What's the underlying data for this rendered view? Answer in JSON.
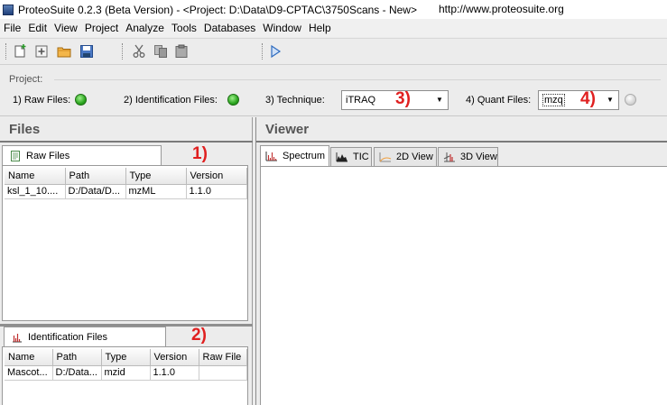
{
  "window": {
    "title": "ProteoSuite 0.2.3 (Beta Version) - <Project: D:\\Data\\D9-CPTAC\\3750Scans - New>",
    "url": "http://www.proteosuite.org"
  },
  "menu": [
    "File",
    "Edit",
    "View",
    "Project",
    "Analyze",
    "Tools",
    "Databases",
    "Window",
    "Help"
  ],
  "toolbar": {
    "icons": [
      "new-file-icon",
      "add-icon",
      "open-folder-icon",
      "save-icon",
      "cut-icon",
      "copy-icon",
      "paste-icon",
      "run-icon"
    ]
  },
  "project": {
    "label": "Project:",
    "raw_files_label": "1) Raw Files:",
    "raw_files_status": "green",
    "id_files_label": "2) Identification Files:",
    "id_files_status": "green",
    "technique_label": "3) Technique:",
    "technique_value": "iTRAQ",
    "quant_files_label": "4) Quant Files:",
    "quant_files_value": "mzq",
    "quant_files_status": "gray"
  },
  "annotations": {
    "a1": "1)",
    "a2": "2)",
    "a3": "3)",
    "a4": "4)"
  },
  "files_panel": {
    "title": "Files",
    "raw_tab": "Raw Files",
    "raw_columns": [
      "Name",
      "Path",
      "Type",
      "Version"
    ],
    "raw_rows": [
      [
        "ksl_1_10....",
        "D:/Data/D...",
        "mzML",
        "1.1.0"
      ]
    ],
    "id_tab": "Identification Files",
    "id_columns": [
      "Name",
      "Path",
      "Type",
      "Version",
      "Raw File"
    ],
    "id_rows": [
      [
        "Mascot...",
        "D:/Data...",
        "mzid",
        "1.1.0",
        ""
      ]
    ]
  },
  "viewer": {
    "title": "Viewer",
    "tabs": [
      "Spectrum",
      "TIC",
      "2D View",
      "3D View"
    ],
    "active_tab": "Spectrum"
  },
  "colors": {
    "annotation_red": "#e02020",
    "status_green": "#2ba51f"
  }
}
